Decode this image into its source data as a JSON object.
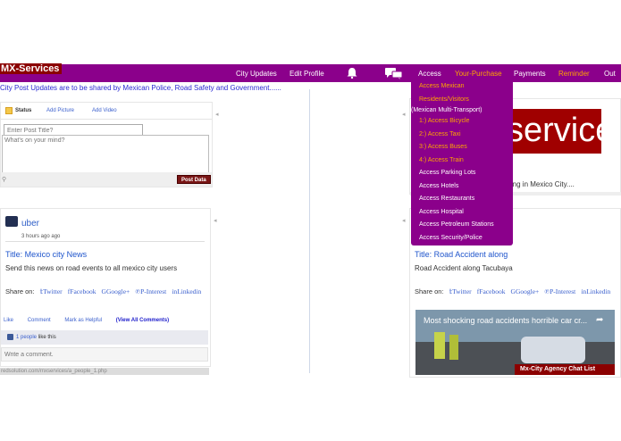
{
  "brand": "MX-Services",
  "nav": {
    "items": [
      "City Updates",
      "Edit Profile"
    ],
    "access": "Access",
    "your_purchase": "Your-Purchase",
    "payments": "Payments",
    "reminder": "Reminder",
    "out": "Out"
  },
  "ticker": "City Post Updates are to be shared by Mexican Police, Road Safety and Government......",
  "post_box": {
    "tabs": [
      "Status",
      "Add Picture",
      "Add Video"
    ],
    "title_placeholder": "Enter Post Title?",
    "body_placeholder": "What's on your mind?",
    "submit": "Post Data"
  },
  "left_post": {
    "user": "uber",
    "time": "3 hours ago ago",
    "title": "Title: Mexico city News",
    "body": "Send this news on road events to all mexico city users",
    "share_label": "Share on:",
    "share_links": [
      "Twitter",
      "Facebook",
      "Google+",
      "P-Interest",
      "Linkedin"
    ],
    "actions": [
      "Like",
      "Comment",
      "Mark as Helpful",
      "(View All Comments)"
    ],
    "likes": "1 people",
    "likes_suffix": "like this",
    "comment_placeholder": "Write a comment."
  },
  "status_url": "redsolution.com/mxservices/a_people_1.php",
  "right_top": {
    "banner": "services",
    "text": "ening in Mexico City...."
  },
  "right_post": {
    "title": "Title: Road Accident along",
    "body": "Road Accident along Tacubaya",
    "share_label": "Share on:",
    "share_links": [
      "Twitter",
      "Facebook",
      "Google+",
      "P-Interest",
      "Linkedin"
    ],
    "video_title": "Most shocking road accidents horrible car cr...",
    "chat_list": "Mx-City Agency Chat List"
  },
  "dropdown": {
    "items": [
      {
        "label": "Access Mexican",
        "color": "orange"
      },
      {
        "label": "Residents/Visitors",
        "color": "orange"
      },
      {
        "label": "(Mexican Multi-Transport)",
        "color": "white"
      },
      {
        "label": "1:) Access Bicycle",
        "color": "orange"
      },
      {
        "label": "2:) Access Taxi",
        "color": "orange"
      },
      {
        "label": "3:) Access Buses",
        "color": "orange"
      },
      {
        "label": "4:) Access Train",
        "color": "orange"
      },
      {
        "label": "Access Parking Lots",
        "color": "white"
      },
      {
        "label": "Access Hotels",
        "color": "white"
      },
      {
        "label": "Access Restaurants",
        "color": "white"
      },
      {
        "label": "Access Hospital",
        "color": "white"
      },
      {
        "label": "Access Petroleum Stations",
        "color": "white"
      },
      {
        "label": "Access Security/Police",
        "color": "white"
      }
    ]
  },
  "colors": {
    "nav_bg": "#8b008b",
    "brand_bg": "#8b0000",
    "accent_orange": "#ffa500",
    "link_blue": "#3a5fcd"
  }
}
